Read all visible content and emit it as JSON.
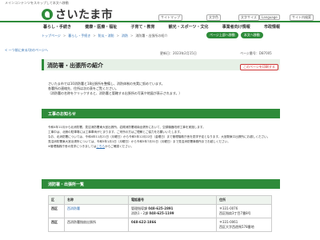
{
  "header": {
    "skip_link": "メインコンテンツをスキップして本文へ移動",
    "logo_text": "さいたま市",
    "utilities": {
      "sitemap": "サイトマップ",
      "lang_label": "文字色",
      "size_label": "文字サイズ",
      "search": "サイト内検索",
      "language": "Language",
      "help": "ホーム/サイトマップ"
    }
  },
  "gnav": [
    "暮らし・手続き",
    "健康・医療・福祉",
    "子育て・教育",
    "観光・スポーツ・文化",
    "事業者向け情報",
    "市政情報"
  ],
  "breadcrumb": {
    "items": [
      "トップページ",
      "暮らし・手続き",
      "防災・消防",
      "消防"
    ],
    "current": "消防署・出張所の紹介"
  },
  "actions": {
    "btn1": "ページ上部へ移動",
    "btn2": "本文へ移動"
  },
  "back_link": "< 一つ前に戻る/次のページへ",
  "page": {
    "title": "消防署・出張所の紹介",
    "updated": "更新日：2023年2月15日",
    "page_id": "ページ番号：D87005",
    "pdf_button": "このページを印刷する"
  },
  "intro": [
    "さいたま市では10消防署と18出張所を整備し、消防体制の充実に努めています。",
    "各署所の連絡先、住所は次の表をご覧ください。",
    "（消防署の名称をクリックすると、消防署と管轄する出張所の写真や地図が表示されます。）"
  ],
  "construction": {
    "heading": "工事のお知らせ",
    "paragraphs": [
      "令和4年11月から北消防署、見沼消防署東大宮出張所、岩槻消防署城南出張所において、空調機器改修工事を実施します。",
      "工事中は、北側の駐車場には工事車両がとまります。ご来所の方はご理解とご協力をお願いいたします。",
      "なお、北消防署については、令和4年11月21日（月曜日）から令和5年12月22日（金曜日）まで管理階救庁舎を見学予定となります。大宮駅東口出張所にお越しください。",
      "見沼消防署東大宮出張所については、令和5年1月1日（月曜日）から令和5年7月31日（月曜日）まで見沼消防署事務所までお越しください。",
      "※管理階救庁舎の見学につきましては"
    ],
    "link_text": "こちら",
    "after_link": "からご確認ください。"
  },
  "stations": {
    "heading": "消防署・出張所一覧",
    "columns": [
      "区",
      "名称",
      "電話番号",
      "住所"
    ],
    "rows": [
      {
        "ward": "西区",
        "name": "西消防署",
        "phone1_label": "管理指導課",
        "phone1": "048-625-2891",
        "phone2_label": "消防1・2課",
        "phone2": "048-625-1199",
        "postal": "〒331-0076",
        "address": "西区指扇3丁目7番8号"
      },
      {
        "ward": "西区",
        "name": "西消防署指扇出張所",
        "phone1_label": "",
        "phone1": "048-622-1866",
        "phone2_label": "",
        "phone2": "",
        "postal": "〒331-0061",
        "address": "西区大字西遊馬578番地"
      }
    ]
  }
}
